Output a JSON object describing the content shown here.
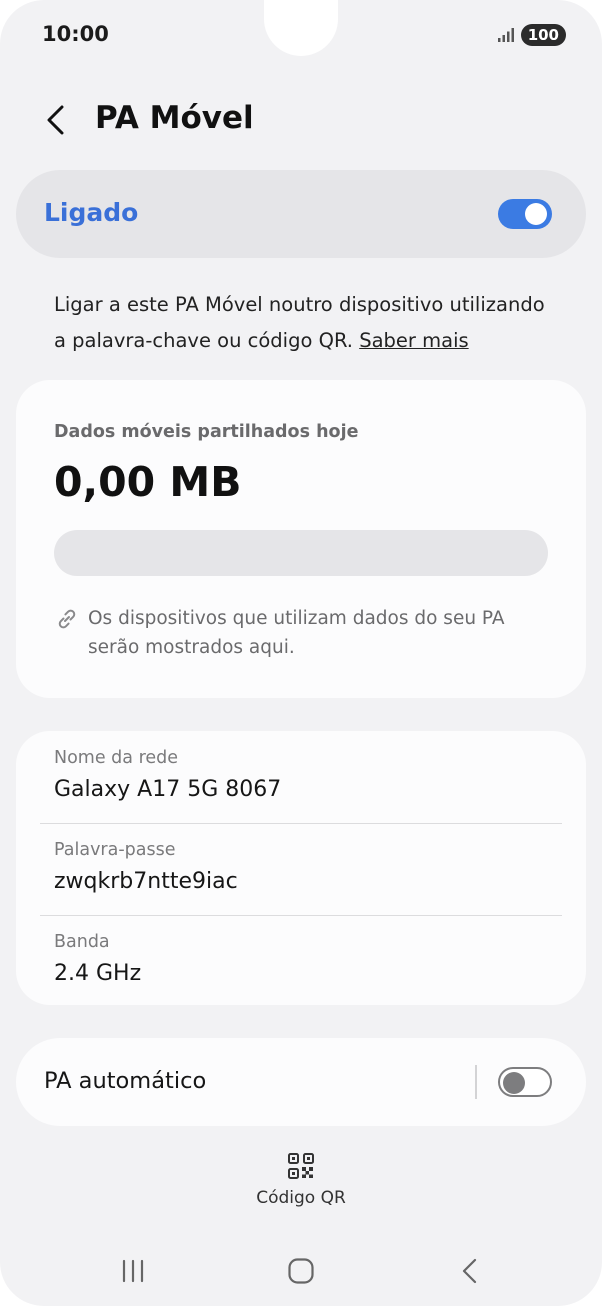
{
  "status": {
    "time": "10:00",
    "battery": "100"
  },
  "header": {
    "title": "PA Móvel"
  },
  "master": {
    "label": "Ligado",
    "on": true
  },
  "description": {
    "text": "Ligar a este PA Móvel noutro dispositivo utilizando a palavra-chave ou código QR. ",
    "link": "Saber mais"
  },
  "usage": {
    "label": "Dados móveis partilhados hoje",
    "value": "0,00 MB",
    "progress": 0,
    "note": "Os dispositivos que utilizam dados do seu PA serão mostrados aqui."
  },
  "network": {
    "name_label": "Nome da rede",
    "name_value": "Galaxy A17 5G 8067",
    "password_label": "Palavra-passe",
    "password_value": "zwqkrb7ntte9iac",
    "band_label": "Banda",
    "band_value": "2.4 GHz"
  },
  "auto": {
    "label": "PA automático",
    "on": false
  },
  "qr": {
    "label": "Código QR"
  },
  "colors": {
    "accent": "#3b7be3",
    "label_blue": "#3a70d8",
    "background": "#f2f2f4"
  }
}
